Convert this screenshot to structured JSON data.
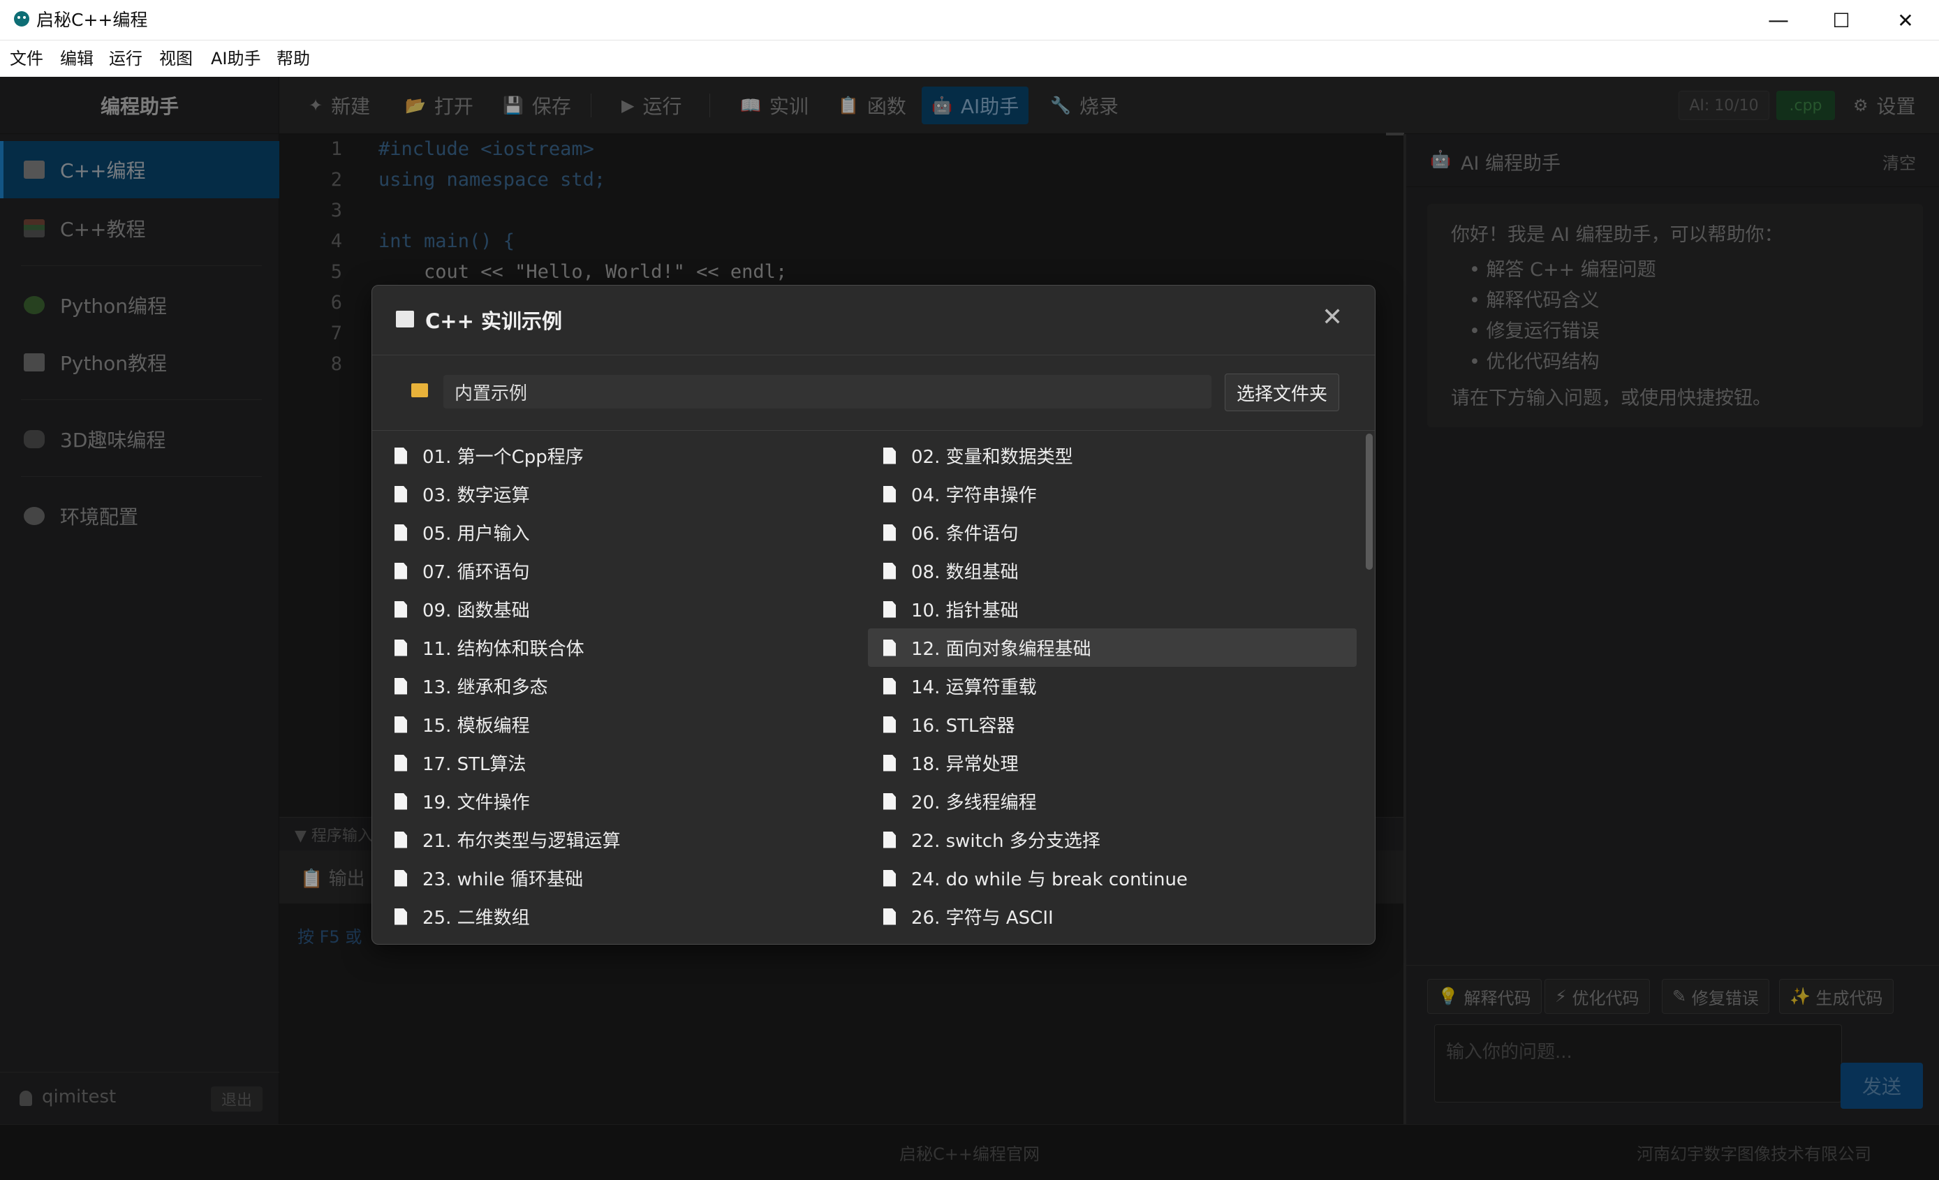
{
  "window": {
    "title": "启秘C++编程",
    "minimize": "—",
    "maximize": "☐",
    "close": "✕"
  },
  "menu": [
    "文件",
    "编辑",
    "运行",
    "视图",
    "AI助手",
    "帮助"
  ],
  "sidebar": {
    "header": "编程助手",
    "items": [
      {
        "label": "C++编程",
        "icon": "edit-doc-icon",
        "active": true
      },
      {
        "label": "C++教程",
        "icon": "books-icon"
      },
      {
        "label": "Python编程",
        "icon": "snake-icon"
      },
      {
        "label": "Python教程",
        "icon": "book-icon"
      },
      {
        "label": "3D趣味编程",
        "icon": "gamepad-icon"
      },
      {
        "label": "环境配置",
        "icon": "gear-icon"
      }
    ],
    "user": "qimitest",
    "logout": "退出"
  },
  "toolbar": {
    "buttons": [
      {
        "label": "新建",
        "glyph": "✦"
      },
      {
        "label": "打开",
        "glyph": "📂"
      },
      {
        "label": "保存",
        "glyph": "💾"
      },
      {
        "label": "运行",
        "glyph": "▶"
      },
      {
        "label": "实训",
        "glyph": "📖"
      },
      {
        "label": "函数",
        "glyph": "📋"
      },
      {
        "label": "AI助手",
        "glyph": "🤖"
      },
      {
        "label": "烧录",
        "glyph": "🔧"
      }
    ],
    "ai_quota": "AI: 10/10",
    "ext": ".cpp",
    "settings": "设置"
  },
  "editor": {
    "line_numbers": [
      "1",
      "2",
      "3",
      "4",
      "5",
      "6",
      "7",
      "8"
    ],
    "lines": [
      {
        "text": "#include <iostream>",
        "color": "#3f6f9a"
      },
      {
        "text": "using namespace std;",
        "color": "#3f6f9a"
      },
      {
        "text": "",
        "color": "#cccccc"
      },
      {
        "text": "int main() {",
        "color": "#3f6f9a"
      },
      {
        "text": "    cout << \"Hello, World!\" << endl;",
        "color": "#b7b7b7"
      }
    ]
  },
  "output": {
    "input_label": "▼ 程序输入",
    "tab_label": "输出",
    "hint": "按 F5 或"
  },
  "ai_panel": {
    "title": "AI 编程助手",
    "clear": "清空",
    "greeting": "你好！我是 AI 编程助手，可以帮助你：",
    "bullets": [
      "解答 C++ 编程问题",
      "解释代码含义",
      "修复运行错误",
      "优化代码结构"
    ],
    "hint": "请在下方输入问题，或使用快捷按钮。",
    "quick_buttons": [
      {
        "label": "解释代码",
        "glyph": "💡"
      },
      {
        "label": "优化代码",
        "glyph": "⚡"
      },
      {
        "label": "修复错误",
        "glyph": "✎"
      },
      {
        "label": "生成代码",
        "glyph": "✨"
      }
    ],
    "input_placeholder": "输入你的问题...",
    "send": "发送"
  },
  "footer": {
    "center": "启秘C++编程官网",
    "right": "河南幻宇数字图像技术有限公司"
  },
  "dialog": {
    "title": "C++ 实训示例",
    "folder": "内置示例",
    "choose_folder": "选择文件夹",
    "examples": [
      "01. 第一个Cpp程序",
      "02. 变量和数据类型",
      "03. 数字运算",
      "04. 字符串操作",
      "05. 用户输入",
      "06. 条件语句",
      "07. 循环语句",
      "08. 数组基础",
      "09. 函数基础",
      "10. 指针基础",
      "11. 结构体和联合体",
      "12. 面向对象编程基础",
      "13. 继承和多态",
      "14. 运算符重载",
      "15. 模板编程",
      "16. STL容器",
      "17. STL算法",
      "18. 异常处理",
      "19. 文件操作",
      "20. 多线程编程",
      "21. 布尔类型与逻辑运算",
      "22. switch 多分支选择",
      "23. while 循环基础",
      "24. do while 与 break continue",
      "25. 二维数组",
      "26. 字符与 ASCII"
    ],
    "highlighted_index": 11
  }
}
